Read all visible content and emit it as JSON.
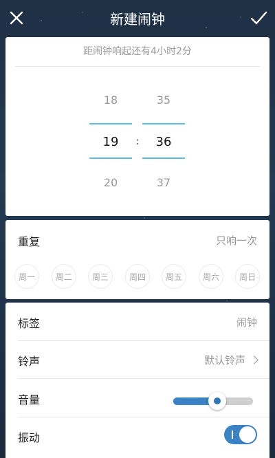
{
  "header": {
    "title": "新建闹钟",
    "close_icon": "close-icon",
    "confirm_icon": "check-icon"
  },
  "time_picker": {
    "hint": "距闹钟响起还有4小时2分",
    "hours": [
      "18",
      "19",
      "20"
    ],
    "minutes": [
      "35",
      "36",
      "37"
    ],
    "selected_hour": "19",
    "selected_minute": "36",
    "separator": ":"
  },
  "repeat": {
    "label": "重复",
    "value": "只响一次",
    "days": [
      "周一",
      "周二",
      "周三",
      "周四",
      "周五",
      "周六",
      "周日"
    ]
  },
  "settings": {
    "tag_label": "标签",
    "tag_value": "闹钟",
    "ringtone_label": "铃声",
    "ringtone_value": "默认铃声",
    "volume_label": "音量",
    "volume_level": 0.55,
    "vibrate_label": "振动",
    "vibrate_on": true
  },
  "colors": {
    "accent": "#3b82c4",
    "picker_line": "#5bc0e0"
  }
}
